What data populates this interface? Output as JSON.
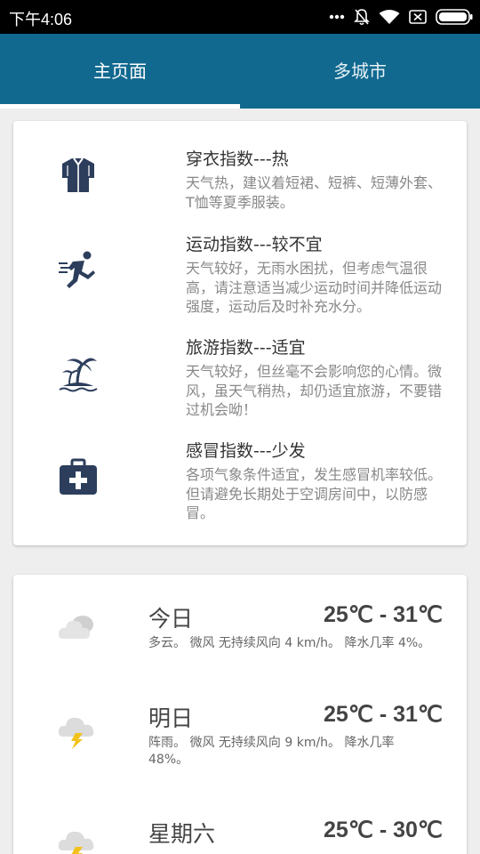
{
  "status_bar": {
    "time": "下午4:06",
    "icons": [
      "more-icon",
      "mute-bell-icon",
      "wifi-icon",
      "no-sim-icon",
      "battery-icon"
    ]
  },
  "tabs": [
    {
      "label": "主页面",
      "selected": true
    },
    {
      "label": "多城市",
      "selected": false
    }
  ],
  "accent_color": "#11698f",
  "indices": [
    {
      "icon": "shirt-icon",
      "title": "穿衣指数---热",
      "desc": "天气热，建议着短裙、短裤、短薄外套、T恤等夏季服装。"
    },
    {
      "icon": "running-icon",
      "title": "运动指数---较不宜",
      "desc": "天气较好，无雨水困扰，但考虑气温很高，请注意适当减少运动时间并降低运动强度，运动后及时补充水分。"
    },
    {
      "icon": "island-icon",
      "title": "旅游指数---适宜",
      "desc": "天气较好，但丝毫不会影响您的心情。微风，虽天气稍热，却仍适宜旅游，不要错过机会呦！"
    },
    {
      "icon": "medical-kit-icon",
      "title": "感冒指数---少发",
      "desc": "各项气象条件适宜，发生感冒机率较低。但请避免长期处于空调房间中，以防感冒。"
    }
  ],
  "forecast": [
    {
      "icon": "cloudy-icon",
      "day": "今日",
      "temp": "25℃ - 31℃",
      "desc": "多云。 微风 无持续风向 4 km/h。 降水几率 4%。"
    },
    {
      "icon": "thunderstorm-icon",
      "day": "明日",
      "temp": "25℃ - 31℃",
      "desc": "阵雨。 微风 无持续风向 9 km/h。 降水几率 48%。"
    },
    {
      "icon": "thunderstorm-icon",
      "day": "星期六",
      "temp": "25℃ - 30℃",
      "desc": ""
    }
  ]
}
